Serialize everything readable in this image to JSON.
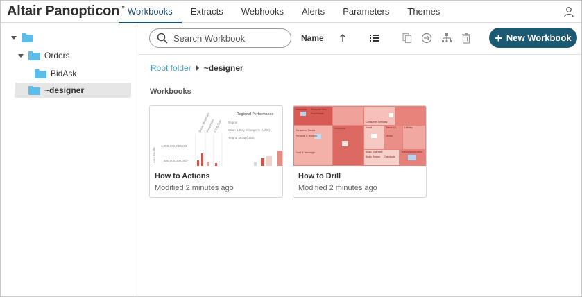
{
  "app": {
    "brand": "Altair Panopticon",
    "brand_mark": "™"
  },
  "nav": {
    "tabs": [
      {
        "label": "Workbooks",
        "active": true
      },
      {
        "label": "Extracts",
        "active": false
      },
      {
        "label": "Webhooks",
        "active": false
      },
      {
        "label": "Alerts",
        "active": false
      },
      {
        "label": "Parameters",
        "active": false
      },
      {
        "label": "Themes",
        "active": false
      }
    ]
  },
  "sidebar": {
    "tree": [
      {
        "label": "",
        "level": 0,
        "expanded": true
      },
      {
        "label": "Orders",
        "level": 1,
        "expanded": true
      },
      {
        "label": "BidAsk",
        "level": 2,
        "expanded": false
      },
      {
        "label": "~designer",
        "level": 1,
        "expanded": false,
        "selected": true
      }
    ]
  },
  "toolbar": {
    "search_placeholder": "Search Workbook",
    "sort_label": "Name",
    "new_button_label": "New Workbook"
  },
  "breadcrumb": {
    "root": "Root folder",
    "current": "~designer"
  },
  "section": {
    "title": "Workbooks"
  },
  "workbooks": [
    {
      "title": "How to Actions",
      "modified": "Modified 2 minutes ago",
      "thumb_text": {
        "heading": "Regional Performance",
        "region": "Region",
        "color": "Color: 1 Day Change % (USD)",
        "height": "Height: MCap(USD)",
        "axis_big": "1,000,000,000,000-",
        "axis_small": "500,000,000,000-",
        "ylabel": "Asia Pacific",
        "cat1": "Basic Materials",
        "cat2": "Financials",
        "cat3": "Oil & Gas"
      }
    },
    {
      "title": "How to Drill",
      "modified": "Modified 2 minutes ago",
      "thumb_text": {
        "t1": "Industrials",
        "t2": "Financial Serv.",
        "t3": "Real Estate",
        "t4": "Consumer Goods",
        "t5": "Industrials",
        "t6": "Retail",
        "t7": "Travel & L.",
        "t8": "Utilities",
        "t9": "Consumer Services",
        "t10": "Personal & Househ.",
        "t11": "Media",
        "t12": "Basic Materials",
        "t13": "Telecommunication",
        "t14": "Food & Beverage",
        "t15": "Basic Resour",
        "t16": "Chemicals"
      }
    }
  ],
  "colors": {
    "accent": "#1c5a73",
    "link": "#4aa3c6",
    "folder": "#5bbde8",
    "treemap_red": "#d9534f"
  }
}
